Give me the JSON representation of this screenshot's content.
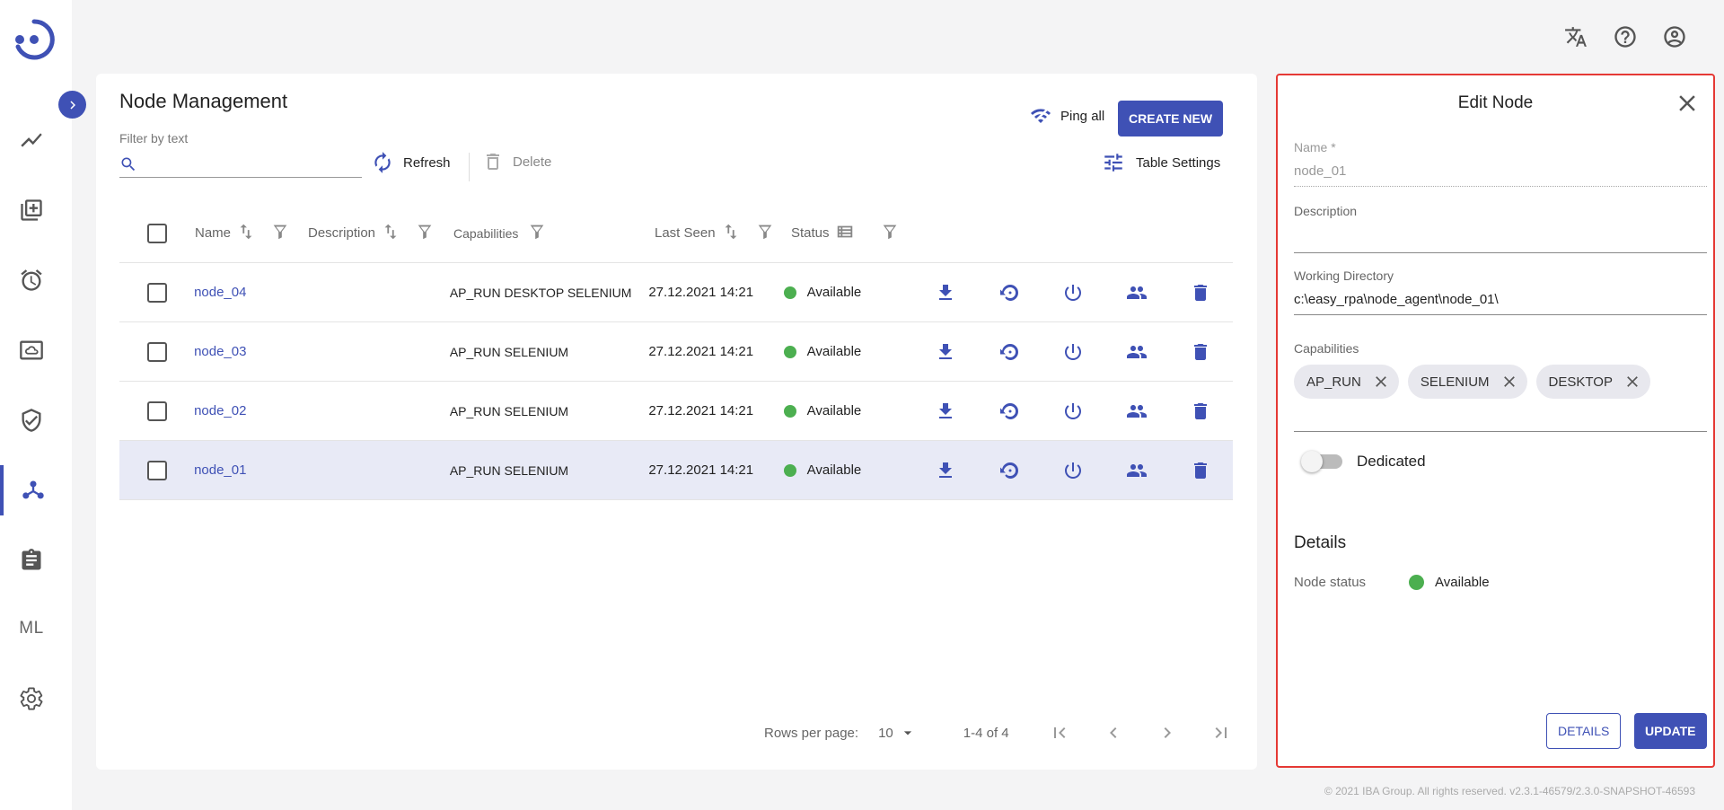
{
  "sidebar": {
    "items": [
      {
        "icon": "chart-line-icon"
      },
      {
        "icon": "library-add-icon"
      },
      {
        "icon": "alarm-clock-icon"
      },
      {
        "icon": "cloud-storage-icon"
      },
      {
        "icon": "shield-check-icon"
      },
      {
        "icon": "node-hub-icon",
        "active": true
      },
      {
        "icon": "clipboard-icon"
      },
      {
        "label": "ML"
      },
      {
        "icon": "gear-icon"
      }
    ]
  },
  "topbar": {
    "icons": [
      "translate-icon",
      "help-icon",
      "account-icon"
    ]
  },
  "main": {
    "title": "Node Management",
    "filter_label": "Filter by text",
    "filter_value": "",
    "refresh_label": "Refresh",
    "delete_label": "Delete",
    "ping_label": "Ping all",
    "create_label": "CREATE NEW",
    "settings_label": "Table Settings",
    "columns": [
      "Name",
      "Description",
      "Capabilities",
      "Last Seen",
      "Status"
    ],
    "rows": [
      {
        "name": "node_04",
        "description": "",
        "capabilities": "AP_RUN DESKTOP SELENIUM",
        "last_seen": "27.12.2021 14:21",
        "status": "Available",
        "selected": false
      },
      {
        "name": "node_03",
        "description": "",
        "capabilities": "AP_RUN SELENIUM",
        "last_seen": "27.12.2021 14:21",
        "status": "Available",
        "selected": false
      },
      {
        "name": "node_02",
        "description": "",
        "capabilities": "AP_RUN SELENIUM",
        "last_seen": "27.12.2021 14:21",
        "status": "Available",
        "selected": false
      },
      {
        "name": "node_01",
        "description": "",
        "capabilities": "AP_RUN SELENIUM",
        "last_seen": "27.12.2021 14:21",
        "status": "Available",
        "selected": true
      }
    ],
    "pager": {
      "rows_per_page_label": "Rows per page:",
      "rows_per_page": "10",
      "range": "1-4 of 4"
    }
  },
  "edit_panel": {
    "title": "Edit Node",
    "name_label": "Name *",
    "name_value": "node_01",
    "description_label": "Description",
    "description_value": "",
    "working_dir_label": "Working Directory",
    "working_dir_value": "c:\\easy_rpa\\node_agent\\node_01\\",
    "capabilities_label": "Capabilities",
    "capabilities": [
      "AP_RUN",
      "SELENIUM",
      "DESKTOP"
    ],
    "dedicated_label": "Dedicated",
    "dedicated": false,
    "details_title": "Details",
    "node_status_label": "Node status",
    "node_status": "Available",
    "details_button": "DETAILS",
    "update_button": "UPDATE"
  },
  "colors": {
    "accent": "#3f51b5",
    "status_available": "#4caf50",
    "panel_border": "#e53935"
  },
  "footer": "© 2021 IBA Group. All rights reserved. v2.3.1-46579/2.3.0-SNAPSHOT-46593"
}
